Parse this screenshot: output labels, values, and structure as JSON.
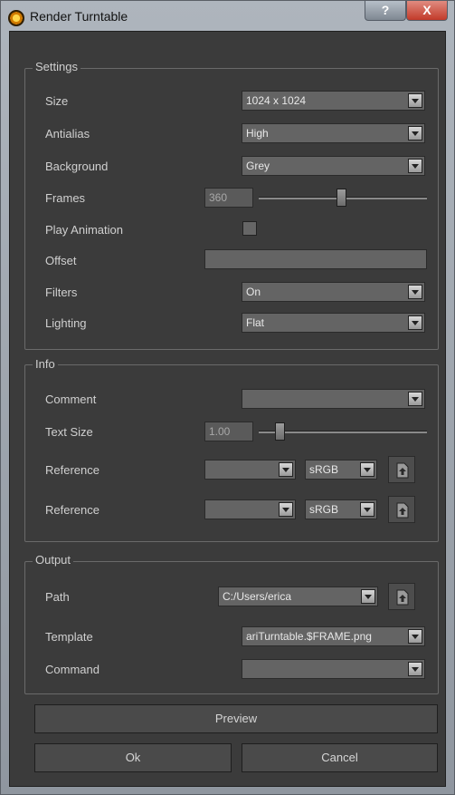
{
  "window": {
    "title": "Render Turntable",
    "help_label": "?",
    "close_label": "X"
  },
  "settings": {
    "group_title": "Settings",
    "size": {
      "label": "Size",
      "value": "1024 x 1024"
    },
    "antialias": {
      "label": "Antialias",
      "value": "High"
    },
    "background": {
      "label": "Background",
      "value": "Grey"
    },
    "frames": {
      "label": "Frames",
      "value": "360",
      "slider_fraction": 0.49
    },
    "play_animation": {
      "label": "Play Animation",
      "checked": false
    },
    "offset": {
      "label": "Offset",
      "value": ""
    },
    "filters": {
      "label": "Filters",
      "value": "On"
    },
    "lighting": {
      "label": "Lighting",
      "value": "Flat"
    }
  },
  "info": {
    "group_title": "Info",
    "comment": {
      "label": "Comment",
      "value": ""
    },
    "text_size": {
      "label": "Text Size",
      "value": "1.00",
      "slider_fraction": 0.1
    },
    "reference1": {
      "label": "Reference",
      "value": "",
      "colorspace": "sRGB",
      "icon": "load-file-icon"
    },
    "reference2": {
      "label": "Reference",
      "value": "",
      "colorspace": "sRGB",
      "icon": "load-file-icon"
    }
  },
  "output": {
    "group_title": "Output",
    "path": {
      "label": "Path",
      "value": "C:/Users/erica",
      "icon": "load-file-icon"
    },
    "template": {
      "label": "Template",
      "value": "ariTurntable.$FRAME.png"
    },
    "command": {
      "label": "Command",
      "value": ""
    }
  },
  "buttons": {
    "preview": "Preview",
    "ok": "Ok",
    "cancel": "Cancel"
  }
}
